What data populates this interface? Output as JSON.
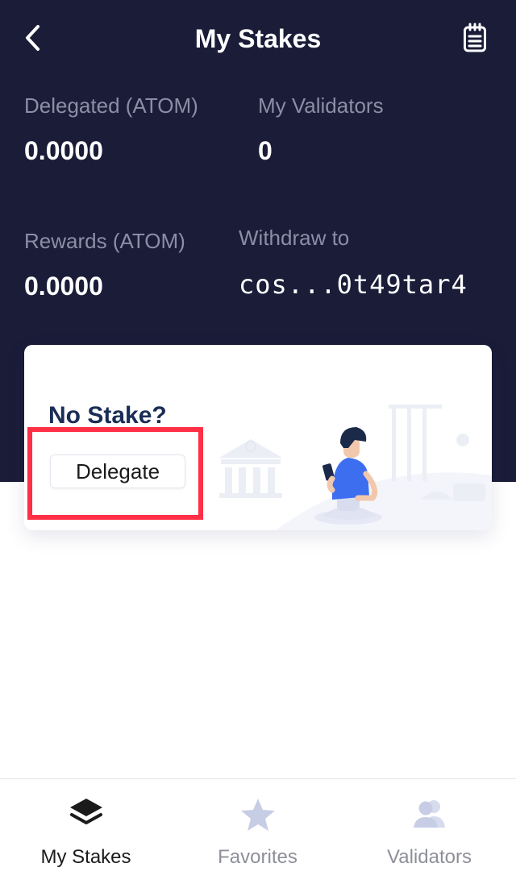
{
  "header": {
    "title": "My Stakes",
    "back_icon": "chevron-left-icon",
    "clipboard_icon": "clipboard-icon",
    "background_color": "#1a1c38"
  },
  "stats": {
    "delegated_label": "Delegated (ATOM)",
    "delegated_value": "0.0000",
    "validators_label": "My Validators",
    "validators_value": "0",
    "rewards_label": "Rewards (ATOM)",
    "rewards_value": "0.0000",
    "withdraw_label": "Withdraw to",
    "withdraw_value": "cos...0t49tar4"
  },
  "card": {
    "title": "No Stake?",
    "button_label": "Delegate",
    "illustration": "person-with-phone-and-bank-illustration",
    "highlight_color": "#ff2f45"
  },
  "tabs": [
    {
      "label": "My Stakes",
      "icon": "layers-icon",
      "active": true
    },
    {
      "label": "Favorites",
      "icon": "star-icon",
      "active": false
    },
    {
      "label": "Validators",
      "icon": "users-icon",
      "active": false
    }
  ],
  "colors": {
    "tab_active": "#1b1b1b",
    "tab_inactive": "#8e9099",
    "tab_icon_inactive": "#c8cde6"
  }
}
